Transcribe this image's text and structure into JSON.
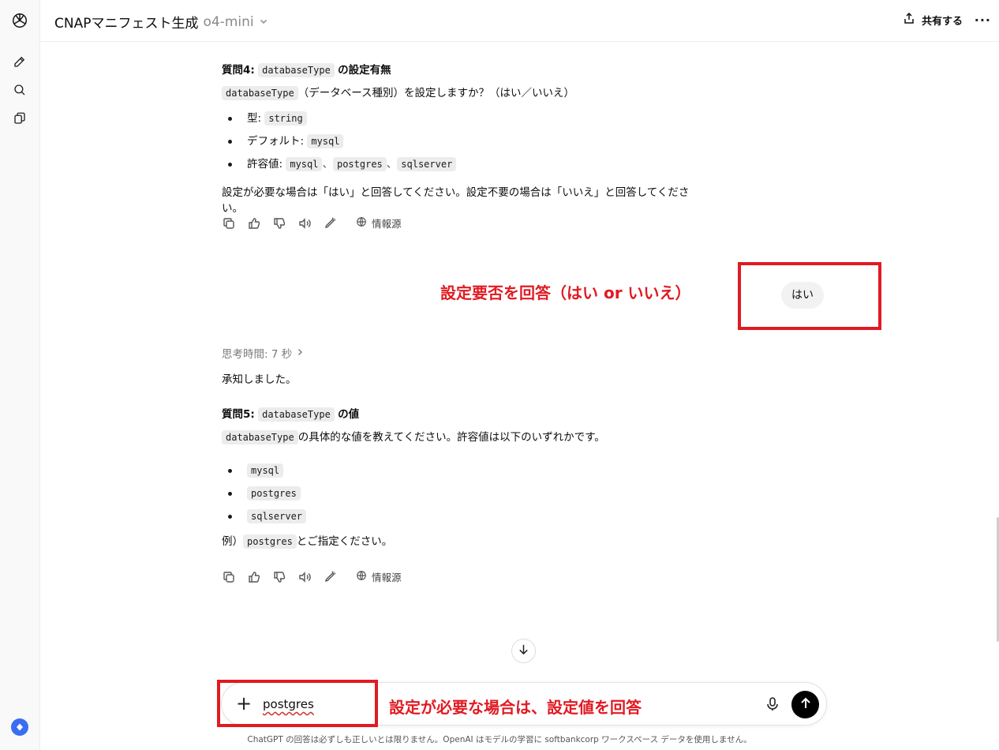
{
  "header": {
    "title": "CNAPマニフェスト生成",
    "model": "o4-mini",
    "share_label": "共有する",
    "more_label": "···"
  },
  "q4": {
    "title_prefix": "質問4:",
    "title_code": "databaseType",
    "title_suffix": "の設定有無",
    "line_code": "databaseType",
    "line_text": "（データベース種別）を設定しますか？（はい／いいえ）",
    "type_label": "型:",
    "type_value": "string",
    "default_label": "デフォルト:",
    "default_value": "mysql",
    "allowed_label": "許容値:",
    "allowed_values": [
      "mysql",
      "postgres",
      "sqlserver"
    ],
    "separator": "、",
    "instruction": "設定が必要な場合は「はい」と回答してください。設定不要の場合は「いいえ」と回答してください。"
  },
  "actions": {
    "sources_label": "情報源"
  },
  "user_message": "はい",
  "annotations": {
    "answer_yes_no": "設定要否を回答（はい or いいえ）",
    "answer_value": "設定が必要な場合は、設定値を回答"
  },
  "thinking": "思考時間: 7 秒",
  "ack": "承知しました。",
  "q5": {
    "title_prefix": "質問5:",
    "title_code": "databaseType",
    "title_suffix": "の値",
    "line_code": "databaseType",
    "line_text": "の具体的な値を教えてください。許容値は以下のいずれかです。",
    "options": [
      "mysql",
      "postgres",
      "sqlserver"
    ],
    "example_prefix": "例）",
    "example_code": "postgres",
    "example_suffix": "とご指定ください。"
  },
  "composer": {
    "value": "postgres"
  },
  "footer": "ChatGPT の回答は必ずしも正しいとは限りません。OpenAI はモデルの学習に softbankcorp ワークスペース データを使用しません。",
  "colors": {
    "annotation_red": "#e11a22",
    "send_button": "#000000"
  }
}
